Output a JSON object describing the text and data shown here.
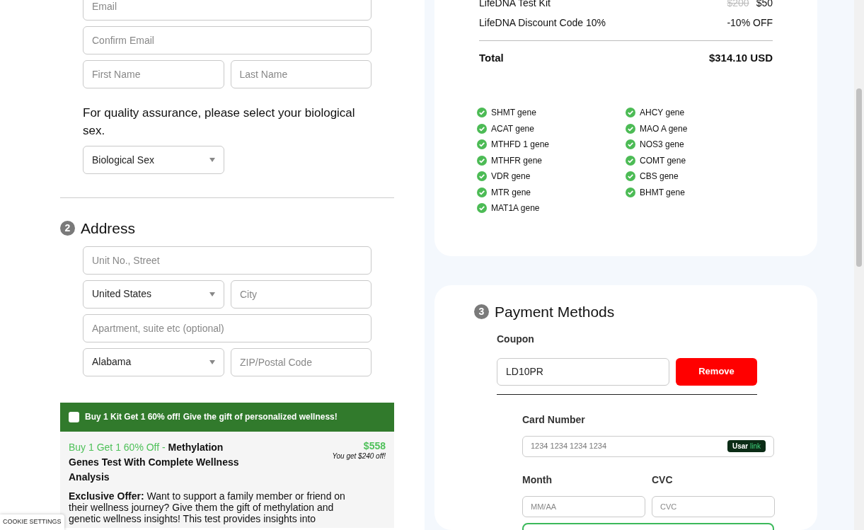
{
  "account": {
    "rows": [
      [
        {
          "kind": "input",
          "placeholder": "Email"
        }
      ],
      [
        {
          "kind": "input",
          "placeholder": "Confirm Email"
        }
      ],
      [
        {
          "kind": "input",
          "placeholder": "First Name"
        },
        {
          "kind": "input",
          "placeholder": "Last Name"
        }
      ]
    ],
    "sex_prompt": "For quality assurance, please select your biological sex.",
    "sex_select": {
      "kind": "select",
      "value": "Biological Sex"
    }
  },
  "address": {
    "step": "2",
    "title": "Address",
    "rows": [
      [
        {
          "kind": "input",
          "placeholder": "Unit No., Street"
        }
      ],
      [
        {
          "kind": "select",
          "value": "United States"
        },
        {
          "kind": "input",
          "placeholder": "City"
        }
      ],
      [
        {
          "kind": "input",
          "placeholder": "Apartment, suite etc (optional)"
        }
      ],
      [
        {
          "kind": "select",
          "value": "Alabama"
        },
        {
          "kind": "input",
          "placeholder": "ZIP/Postal Code"
        }
      ]
    ]
  },
  "offer": {
    "checked": false,
    "banner": "Buy 1 Kit Get 1 60% off! Give the gift of personalized wellness!",
    "title_prefix": "Buy 1 Get 1 60% Off - ",
    "title": "Methylation Genes Test With Complete Wellness Analysis",
    "price": "$558",
    "savings": "You get $240 off!",
    "description": "**Exclusive Offer:** Want to support a family member or friend on their wellness journey? Give them the gift of methylation and genetic wellness insights! This test provides insights into"
  },
  "order_summary": {
    "items": [
      {
        "name": "LifeDNA Test Kit",
        "old_price": "$200",
        "price": "$50"
      },
      {
        "name": "LifeDNA Discount Code 10%",
        "price": "-10% OFF"
      }
    ],
    "total_label": "Total",
    "total": "$314.10 USD",
    "genes": [
      "SHMT gene",
      "ACAT gene",
      "MTHFD 1 gene",
      "MTHFR gene",
      "VDR gene",
      "MTR gene",
      "MAT1A gene",
      "AHCY gene",
      "MAO A gene",
      "NOS3 gene",
      "COMT gene",
      "CBS gene",
      "BHMT gene"
    ]
  },
  "payment": {
    "step": "3",
    "title": "Payment Methods",
    "coupon_label": "Coupon",
    "coupon_value": "LD10PR",
    "remove_button": "Remove",
    "card_label": "Card Number",
    "card_placeholder": "1234 1234 1234 1234",
    "link_badge": {
      "prefix": "Usar",
      "brand": "link"
    },
    "month_label": "Month",
    "month_placeholder": "MM/AA",
    "cvc_label": "CVC",
    "cvc_placeholder": "CVC"
  },
  "cookie_button": "COOKIE SETTINGS"
}
